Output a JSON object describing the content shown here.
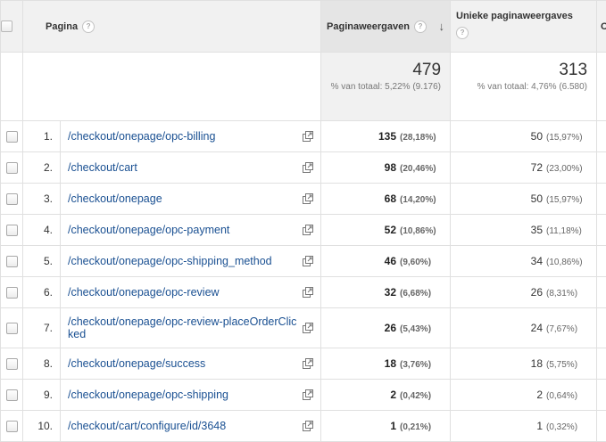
{
  "columns": {
    "page": "Pagina",
    "pageviews": "Paginaweergaven",
    "unique_pageviews": "Unieke paginaweergaves",
    "edge": "C",
    "help": "?"
  },
  "totals": {
    "pageviews": "479",
    "pageviews_sub": "% van totaal: 5,22% (9.176)",
    "unique_pageviews": "313",
    "unique_pageviews_sub": "% van totaal: 4,76% (6.580)"
  },
  "rows": [
    {
      "index": "1.",
      "page": "/checkout/onepage/opc-billing",
      "pageviews": "135",
      "pageviews_pct": "(28,18%)",
      "unique": "50",
      "unique_pct": "(15,97%)"
    },
    {
      "index": "2.",
      "page": "/checkout/cart",
      "pageviews": "98",
      "pageviews_pct": "(20,46%)",
      "unique": "72",
      "unique_pct": "(23,00%)"
    },
    {
      "index": "3.",
      "page": "/checkout/onepage",
      "pageviews": "68",
      "pageviews_pct": "(14,20%)",
      "unique": "50",
      "unique_pct": "(15,97%)"
    },
    {
      "index": "4.",
      "page": "/checkout/onepage/opc-payment",
      "pageviews": "52",
      "pageviews_pct": "(10,86%)",
      "unique": "35",
      "unique_pct": "(11,18%)"
    },
    {
      "index": "5.",
      "page": "/checkout/onepage/opc-shipping_method",
      "pageviews": "46",
      "pageviews_pct": "(9,60%)",
      "unique": "34",
      "unique_pct": "(10,86%)"
    },
    {
      "index": "6.",
      "page": "/checkout/onepage/opc-review",
      "pageviews": "32",
      "pageviews_pct": "(6,68%)",
      "unique": "26",
      "unique_pct": "(8,31%)"
    },
    {
      "index": "7.",
      "page": "/checkout/onepage/opc-review-placeOrderClicked",
      "pageviews": "26",
      "pageviews_pct": "(5,43%)",
      "unique": "24",
      "unique_pct": "(7,67%)"
    },
    {
      "index": "8.",
      "page": "/checkout/onepage/success",
      "pageviews": "18",
      "pageviews_pct": "(3,76%)",
      "unique": "18",
      "unique_pct": "(5,75%)"
    },
    {
      "index": "9.",
      "page": "/checkout/onepage/opc-shipping",
      "pageviews": "2",
      "pageviews_pct": "(0,42%)",
      "unique": "2",
      "unique_pct": "(0,64%)"
    },
    {
      "index": "10.",
      "page": "/checkout/cart/configure/id/3648",
      "pageviews": "1",
      "pageviews_pct": "(0,21%)",
      "unique": "1",
      "unique_pct": "(0,32%)"
    }
  ],
  "icons": {
    "external_link": "external-link-icon",
    "sort": "sort-descending-icon",
    "help": "help-icon"
  }
}
